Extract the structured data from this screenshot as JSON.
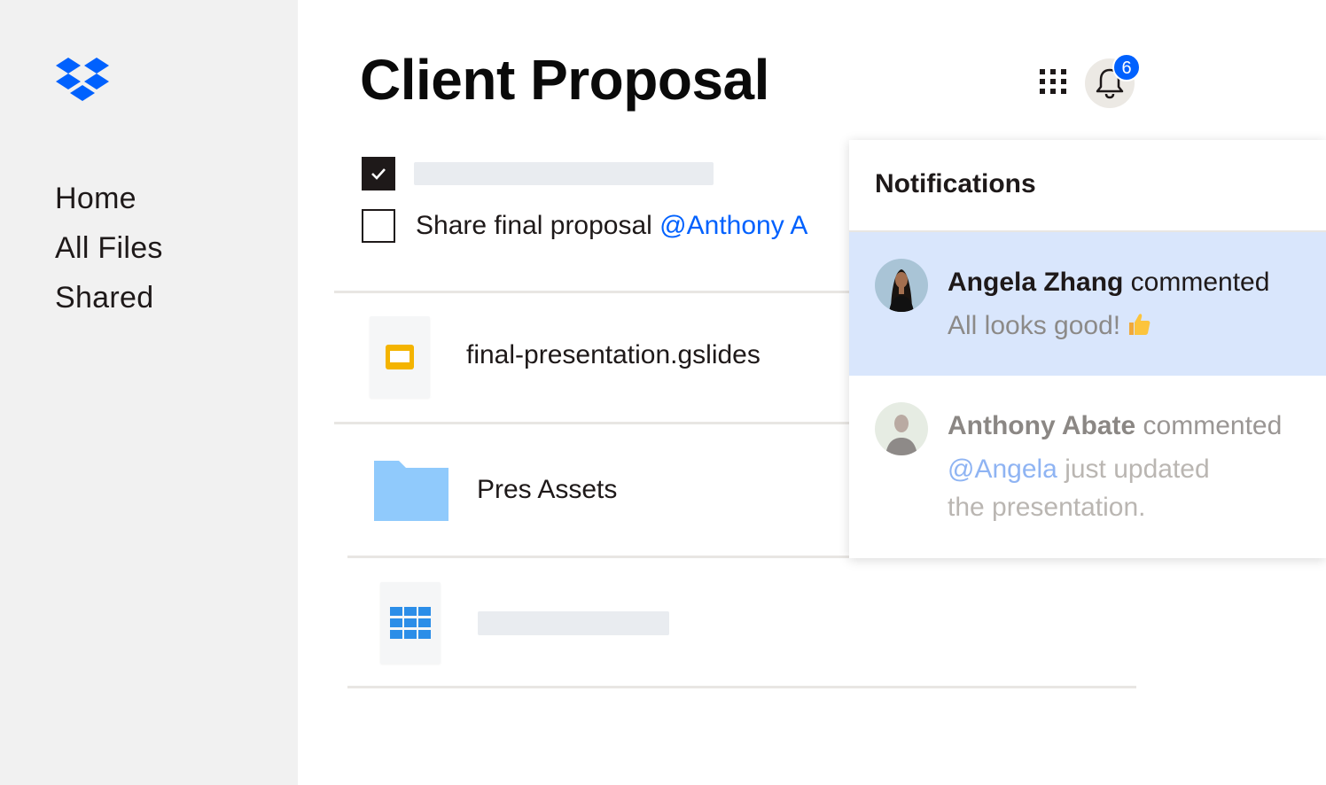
{
  "sidebar": {
    "logo": "dropbox-logo",
    "items": [
      {
        "label": "Home"
      },
      {
        "label": "All Files"
      },
      {
        "label": "Shared"
      }
    ]
  },
  "page": {
    "title": "Client Proposal"
  },
  "header": {
    "apps_icon": "grid-icon",
    "bell_icon": "bell-icon",
    "notification_count": "6"
  },
  "tasks": [
    {
      "checked": true,
      "text": ""
    },
    {
      "checked": false,
      "text": "Share final proposal ",
      "mention": "@Anthony A"
    }
  ],
  "files": [
    {
      "name": "final-presentation.gslides",
      "icon": "slides-icon"
    },
    {
      "name": "Pres Assets",
      "icon": "folder-icon"
    },
    {
      "name": "",
      "icon": "spreadsheet-icon"
    }
  ],
  "notifications": {
    "title": "Notifications",
    "items": [
      {
        "author": "Angela Zhang",
        "action": " commented",
        "message": "All looks good!",
        "emoji": "thumbs-up"
      },
      {
        "author": "Anthony Abate",
        "action": " commented",
        "mention": "@Angela",
        "message_line1": " just updated",
        "message_line2": "the presentation."
      }
    ]
  },
  "colors": {
    "accent": "#0061fe",
    "sidebar_bg": "#f1f1f1",
    "highlight": "#d9e6fc"
  }
}
